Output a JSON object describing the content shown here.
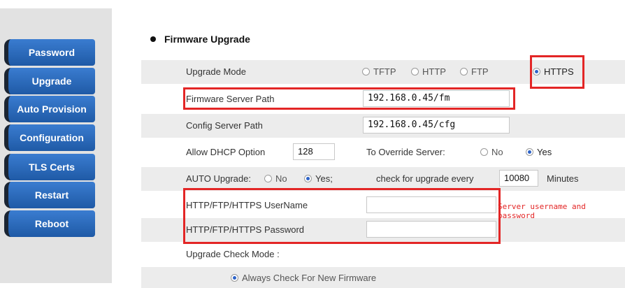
{
  "sidebar": {
    "items": [
      {
        "label": "Password"
      },
      {
        "label": "Upgrade"
      },
      {
        "label": "Auto Provision"
      },
      {
        "label": "Configuration"
      },
      {
        "label": "TLS Certs"
      },
      {
        "label": "Restart"
      },
      {
        "label": "Reboot"
      }
    ]
  },
  "section": {
    "title": "Firmware Upgrade"
  },
  "upgrade_mode": {
    "label": "Upgrade Mode",
    "options": [
      "TFTP",
      "HTTP",
      "FTP",
      "HTTPS"
    ],
    "selected": "HTTPS"
  },
  "firmware_server_path": {
    "label": "Firmware Server Path",
    "value": "192.168.0.45/fm"
  },
  "config_server_path": {
    "label": "Config Server Path",
    "value": "192.168.0.45/cfg"
  },
  "dhcp": {
    "label": "Allow DHCP Option",
    "value": "128",
    "override_label": "To Override Server:",
    "options": [
      "No",
      "Yes"
    ],
    "selected": "Yes"
  },
  "auto_upgrade": {
    "label": "AUTO Upgrade:",
    "options": [
      "No",
      "Yes;"
    ],
    "selected": "Yes;",
    "check_label": "check for upgrade every",
    "interval": "10080",
    "unit": "Minutes"
  },
  "username": {
    "label": "HTTP/FTP/HTTPS UserName",
    "value": ""
  },
  "password": {
    "label": "HTTP/FTP/HTTPS Password",
    "value": ""
  },
  "annotation": {
    "text": "Server username and password"
  },
  "check_mode": {
    "label": "Upgrade Check Mode :",
    "option": "Always Check For New Firmware"
  },
  "colors": {
    "accent": "#2d63c8",
    "highlight": "#e32626",
    "nav": "#1f5aa6"
  }
}
